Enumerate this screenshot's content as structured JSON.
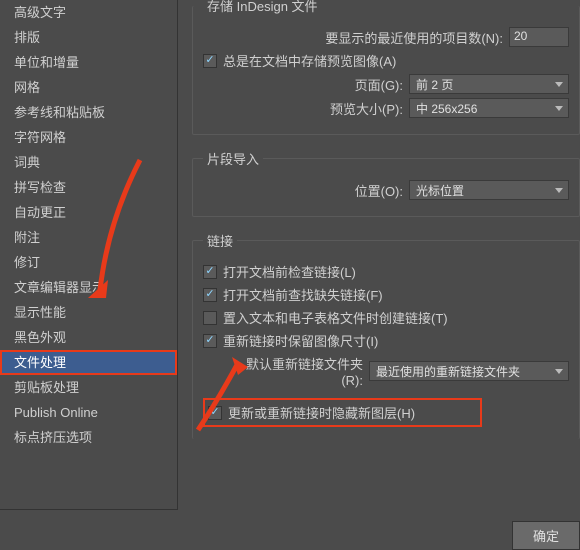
{
  "sidebar": {
    "items": [
      "高级文字",
      "排版",
      "单位和增量",
      "网格",
      "参考线和粘贴板",
      "字符网格",
      "词典",
      "拼写检查",
      "自动更正",
      "附注",
      "修订",
      "文章编辑器显示",
      "显示性能",
      "黑色外观",
      "文件处理",
      "剪贴板处理",
      "Publish Online",
      "标点挤压选项"
    ],
    "selected_index": 14
  },
  "sections": {
    "save": {
      "legend": "存储 InDesign 文件",
      "recent_label": "要显示的最近使用的项目数(N):",
      "recent_underline": "N",
      "recent_value": "20",
      "always_preview": "总是在文档中存储预览图像(A)",
      "always_preview_underline": "A",
      "always_preview_checked": true,
      "page_label": "页面(G):",
      "page_underline": "G",
      "page_value": "前 2 页",
      "preview_size_label": "预览大小(P):",
      "preview_size_underline": "P",
      "preview_size_value": "中 256x256"
    },
    "fragment": {
      "legend": "片段导入",
      "position_label": "位置(O):",
      "position_underline": "O",
      "position_value": "光标位置"
    },
    "links": {
      "legend": "链接",
      "check_links": "打开文档前检查链接(L)",
      "check_links_underline": "L",
      "check_links_checked": true,
      "find_missing": "打开文档前查找缺失链接(F)",
      "find_missing_underline": "F",
      "find_missing_checked": true,
      "create_text_links": "置入文本和电子表格文件时创建链接(T)",
      "create_text_links_underline": "T",
      "create_text_links_checked": false,
      "keep_dims": "重新链接时保留图像尺寸(I)",
      "keep_dims_underline": "I",
      "keep_dims_checked": true,
      "relink_folder_label": "默认重新链接文件夹(R):",
      "relink_folder_underline": "R",
      "relink_folder_value": "最近使用的重新链接文件夹",
      "hide_layers": "更新或重新链接时隐藏新图层(H)",
      "hide_layers_underline": "H",
      "hide_layers_checked": true
    }
  },
  "buttons": {
    "ok": "确定"
  },
  "colors": {
    "highlight": "#e83a1a",
    "selection": "#3d5d90",
    "bg": "#4b4b4b"
  }
}
